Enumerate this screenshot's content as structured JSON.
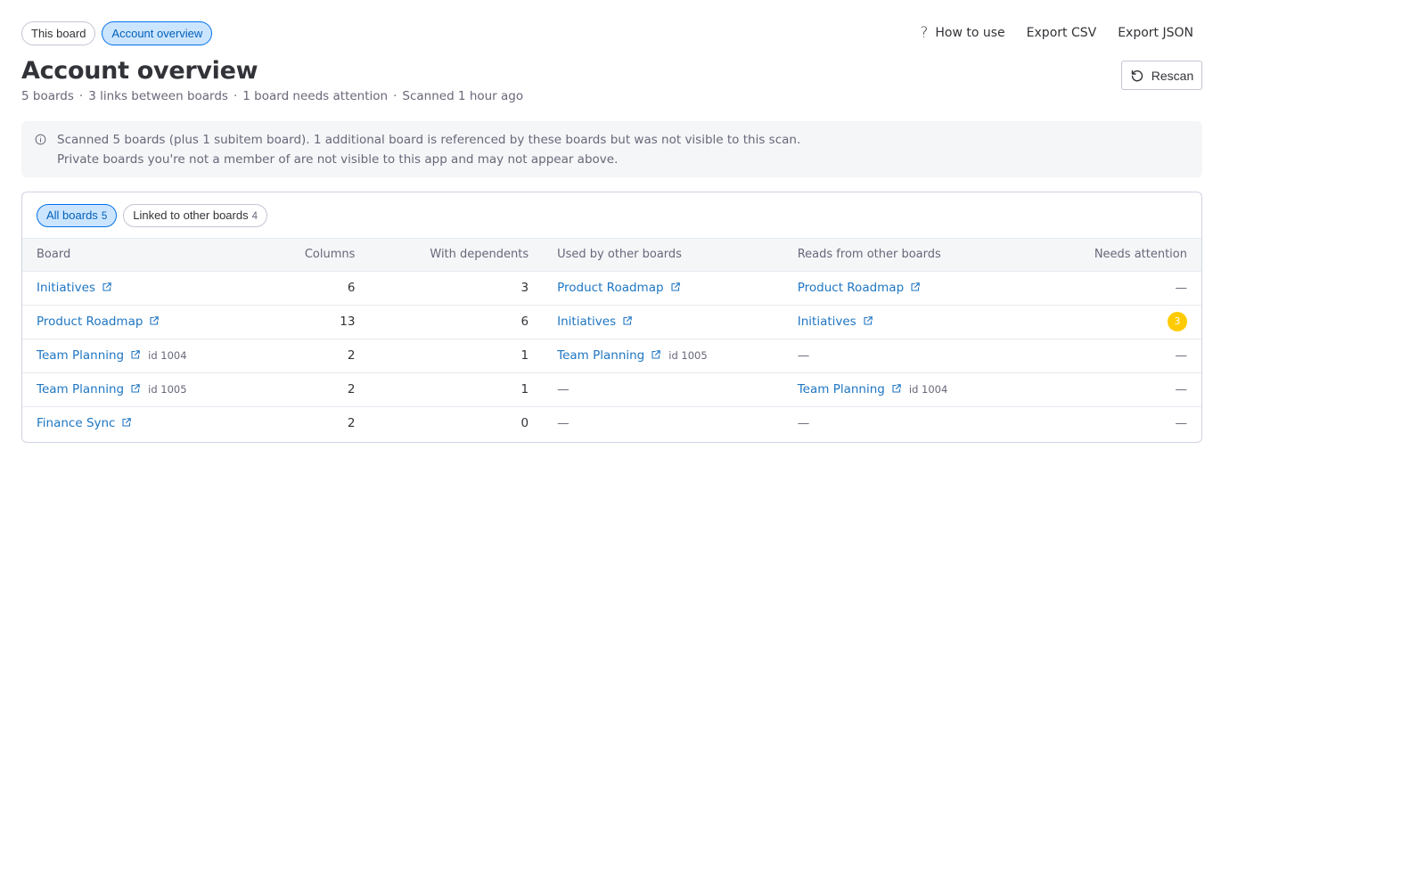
{
  "header": {
    "view_tabs": [
      {
        "label": "This board",
        "active": false
      },
      {
        "label": "Account overview",
        "active": true
      }
    ],
    "actions": {
      "how_to_use": "How to use",
      "export_csv": "Export CSV",
      "export_json": "Export JSON"
    },
    "title": "Account overview",
    "summary": [
      "5 boards",
      "3 links between boards",
      "1 board needs attention",
      "Scanned 1 hour ago"
    ],
    "summary_separator": "·",
    "rescan_label": "Rescan"
  },
  "notice": {
    "line1": "Scanned 5 boards (plus 1 subitem board). 1 additional board is referenced by these boards but was not visible to this scan.",
    "line2": "Private boards you're not a member of are not visible to this app and may not appear above."
  },
  "filters": [
    {
      "label": "All boards",
      "count": "5",
      "active": true
    },
    {
      "label": "Linked to other boards",
      "count": "4",
      "active": false
    }
  ],
  "table": {
    "columns": [
      "Board",
      "Columns",
      "With dependents",
      "Used by other boards",
      "Reads from other boards",
      "Needs attention"
    ],
    "empty_marker": "—",
    "rows": [
      {
        "board": {
          "name": "Initiatives",
          "id": ""
        },
        "columns": "6",
        "with_dependents": "3",
        "used_by": {
          "name": "Product Roadmap",
          "id": ""
        },
        "reads_from": {
          "name": "Product Roadmap",
          "id": ""
        },
        "needs_attention": ""
      },
      {
        "board": {
          "name": "Product Roadmap",
          "id": ""
        },
        "columns": "13",
        "with_dependents": "6",
        "used_by": {
          "name": "Initiatives",
          "id": ""
        },
        "reads_from": {
          "name": "Initiatives",
          "id": ""
        },
        "needs_attention": "3"
      },
      {
        "board": {
          "name": "Team Planning",
          "id": "id 1004"
        },
        "columns": "2",
        "with_dependents": "1",
        "used_by": {
          "name": "Team Planning",
          "id": "id 1005"
        },
        "reads_from": null,
        "needs_attention": ""
      },
      {
        "board": {
          "name": "Team Planning",
          "id": "id 1005"
        },
        "columns": "2",
        "with_dependents": "1",
        "used_by": null,
        "reads_from": {
          "name": "Team Planning",
          "id": "id 1004"
        },
        "needs_attention": ""
      },
      {
        "board": {
          "name": "Finance Sync",
          "id": ""
        },
        "columns": "2",
        "with_dependents": "0",
        "used_by": null,
        "reads_from": null,
        "needs_attention": ""
      }
    ]
  },
  "colors": {
    "accent": "#0073ea",
    "link": "#1f76c2",
    "attention_badge": "#ffcb00",
    "notice_bg": "#f5f6f8"
  },
  "icons": {
    "help": "question-mark-icon",
    "rescan": "refresh-icon",
    "info": "info-icon",
    "external_link": "external-link-icon"
  }
}
